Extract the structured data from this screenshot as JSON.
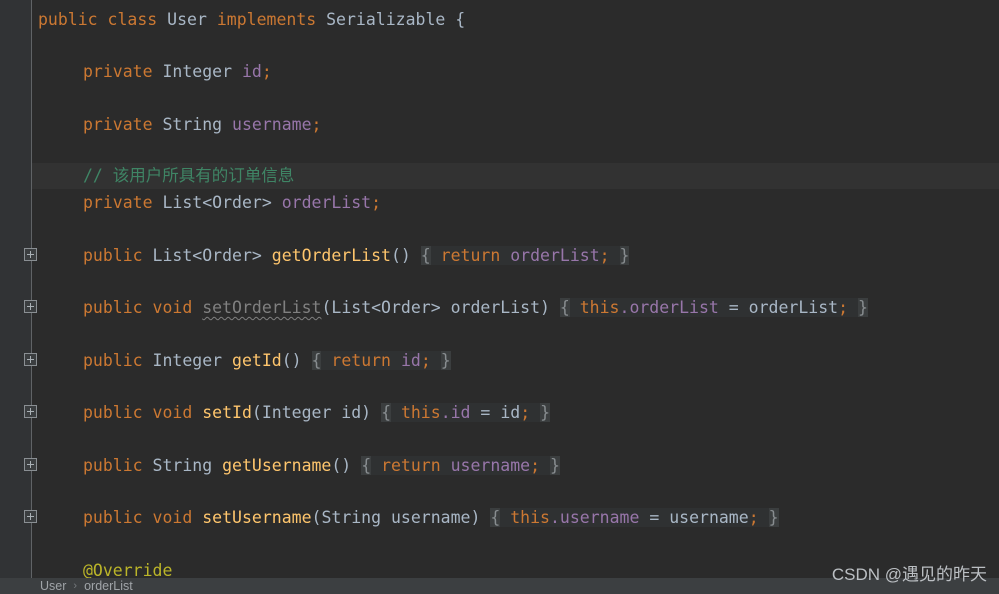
{
  "editor": {
    "theme": "darcula",
    "background": "#2b2b2b",
    "gutter_background": "#313335",
    "current_line_background": "#323232",
    "colors": {
      "keyword": "#cc7832",
      "type": "#a9b7c6",
      "field": "#9876aa",
      "method": "#ffc66d",
      "comment": "#3f8565",
      "annotation": "#bbb529",
      "unused": "#808080",
      "text": "#a9b7c6"
    },
    "lines": [
      {
        "n": 1,
        "fold": false,
        "current": false,
        "indent": 0,
        "text": "public class User implements Serializable {"
      },
      {
        "n": 2,
        "fold": false,
        "current": false,
        "indent": 1,
        "text": ""
      },
      {
        "n": 3,
        "fold": false,
        "current": false,
        "indent": 1,
        "text": "private Integer id;"
      },
      {
        "n": 4,
        "fold": false,
        "current": false,
        "indent": 1,
        "text": ""
      },
      {
        "n": 5,
        "fold": false,
        "current": false,
        "indent": 1,
        "text": "private String username;"
      },
      {
        "n": 6,
        "fold": false,
        "current": false,
        "indent": 1,
        "text": ""
      },
      {
        "n": 7,
        "fold": false,
        "current": true,
        "indent": 1,
        "text": "// 该用户所具有的订单信息"
      },
      {
        "n": 8,
        "fold": false,
        "current": false,
        "indent": 1,
        "text": "private List<Order> orderList;"
      },
      {
        "n": 9,
        "fold": false,
        "current": false,
        "indent": 1,
        "text": ""
      },
      {
        "n": 10,
        "fold": true,
        "current": false,
        "indent": 1,
        "text": "public List<Order> getOrderList() { return orderList; }"
      },
      {
        "n": 11,
        "fold": false,
        "current": false,
        "indent": 1,
        "text": ""
      },
      {
        "n": 12,
        "fold": true,
        "current": false,
        "indent": 1,
        "text": "public void setOrderList(List<Order> orderList) { this.orderList = orderList; }"
      },
      {
        "n": 13,
        "fold": false,
        "current": false,
        "indent": 1,
        "text": ""
      },
      {
        "n": 14,
        "fold": true,
        "current": false,
        "indent": 1,
        "text": "public Integer getId() { return id; }"
      },
      {
        "n": 15,
        "fold": false,
        "current": false,
        "indent": 1,
        "text": ""
      },
      {
        "n": 16,
        "fold": true,
        "current": false,
        "indent": 1,
        "text": "public void setId(Integer id) { this.id = id; }"
      },
      {
        "n": 17,
        "fold": false,
        "current": false,
        "indent": 1,
        "text": ""
      },
      {
        "n": 18,
        "fold": true,
        "current": false,
        "indent": 1,
        "text": "public String getUsername() { return username; }"
      },
      {
        "n": 19,
        "fold": false,
        "current": false,
        "indent": 1,
        "text": ""
      },
      {
        "n": 20,
        "fold": true,
        "current": false,
        "indent": 1,
        "text": "public void setUsername(String username) { this.username = username; }"
      },
      {
        "n": 21,
        "fold": false,
        "current": false,
        "indent": 1,
        "text": ""
      },
      {
        "n": 22,
        "fold": false,
        "current": false,
        "indent": 1,
        "text": "@Override"
      }
    ],
    "tokens": {
      "l1": {
        "k1": "public",
        "k2": "class",
        "t1": "User",
        "k3": "implements",
        "t2": "Serializable",
        "brace": "{"
      },
      "l3": {
        "k1": "private",
        "t1": "Integer",
        "f1": "id",
        "semi": ";"
      },
      "l5": {
        "k1": "private",
        "t1": "String",
        "f1": "username",
        "semi": ";"
      },
      "l7": {
        "comment": "// 该用户所具有的订单信息"
      },
      "l8": {
        "k1": "private",
        "t1": "List<Order>",
        "f1": "orderList",
        "semi": ";"
      },
      "l10": {
        "k1": "public",
        "t1": "List<Order>",
        "m1": "getOrderList",
        "paren": "()",
        "ob": "{",
        "k2": "return",
        "f1": "orderList",
        "semi": ";",
        "cb": "}"
      },
      "l12": {
        "k1": "public",
        "k2": "void",
        "m1": "setOrderList",
        "sig": "(List<Order> orderList)",
        "ob": "{",
        "k3": "this",
        "dot": ".",
        "f1": "orderList",
        "eq": " = ",
        "p1": "orderList",
        "semi": ";",
        "cb": "}"
      },
      "l14": {
        "k1": "public",
        "t1": "Integer",
        "m1": "getId",
        "paren": "()",
        "ob": "{",
        "k2": "return",
        "f1": "id",
        "semi": ";",
        "cb": "}"
      },
      "l16": {
        "k1": "public",
        "k2": "void",
        "m1": "setId",
        "sig": "(Integer id)",
        "ob": "{",
        "k3": "this",
        "dot": ".",
        "f1": "id",
        "eq": " = ",
        "p1": "id",
        "semi": ";",
        "cb": "}"
      },
      "l18": {
        "k1": "public",
        "t1": "String",
        "m1": "getUsername",
        "paren": "()",
        "ob": "{",
        "k2": "return",
        "f1": "username",
        "semi": ";",
        "cb": "}"
      },
      "l20": {
        "k1": "public",
        "k2": "void",
        "m1": "setUsername",
        "sig": "(String username)",
        "ob": "{",
        "k3": "this",
        "dot": ".",
        "f1": "username",
        "eq": " = ",
        "p1": "username",
        "semi": ";",
        "cb": "}"
      },
      "l22": {
        "annotation": "@Override"
      }
    }
  },
  "breadcrumb": {
    "class": "User",
    "separator": "›",
    "member": "orderList"
  },
  "watermark": {
    "text": "CSDN @遇见的昨天"
  }
}
